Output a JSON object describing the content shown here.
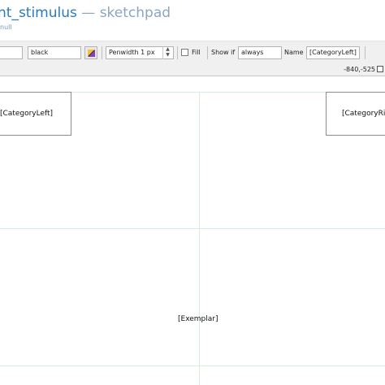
{
  "header": {
    "title_name": "nt_stimulus",
    "title_separator": " — ",
    "title_type": "sketchpad",
    "subtitle": "null"
  },
  "toolbar": {
    "color_value": "black",
    "penwidth_value": "Penwidth 1 px",
    "fill_label": "Fill",
    "fill_checked": false,
    "show_if_label": "Show if",
    "show_if_value": "always",
    "name_label": "Name",
    "name_value": "[CategoryLeft]",
    "coordinates": "-840,-525"
  },
  "canvas": {
    "items": {
      "category_left": "[CategoryLeft]",
      "category_right": "[CategoryRi",
      "exemplar": "[Exemplar]"
    }
  },
  "colors": {
    "title": "#2a7bbd",
    "toolbar_bg": "#f0f0f0",
    "grid": "#d6eeda"
  }
}
